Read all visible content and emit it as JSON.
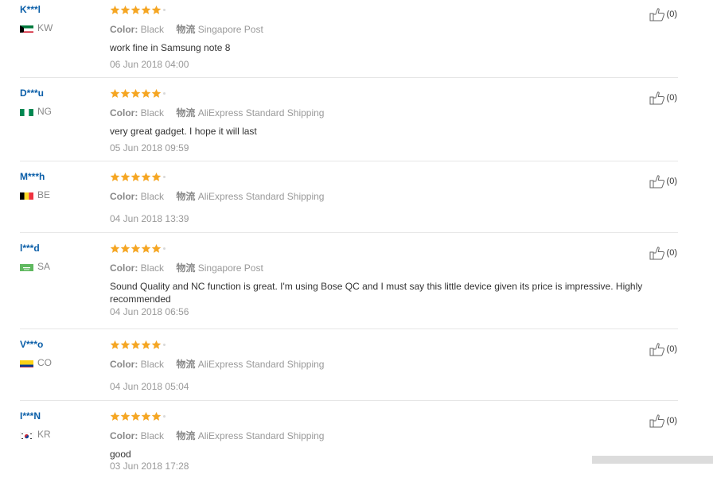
{
  "reviews": [
    {
      "user": "K***l",
      "country": "KW",
      "rating": 5,
      "color_label": "Color:",
      "color": "Black",
      "shipping_label": "物流",
      "shipping": "Singapore Post",
      "content": "work fine in Samsung note 8",
      "date": "06 Jun 2018 04:00",
      "helpful": "(0)"
    },
    {
      "user": "D***u",
      "country": "NG",
      "rating": 5,
      "color_label": "Color:",
      "color": "Black",
      "shipping_label": "物流",
      "shipping": "AliExpress Standard Shipping",
      "content": "very great gadget. I hope it will last",
      "date": "05 Jun 2018 09:59",
      "helpful": "(0)"
    },
    {
      "user": "M***h",
      "country": "BE",
      "rating": 5,
      "color_label": "Color:",
      "color": "Black",
      "shipping_label": "物流",
      "shipping": "AliExpress Standard Shipping",
      "content": "",
      "date": "04 Jun 2018 13:39",
      "helpful": "(0)"
    },
    {
      "user": "l***d",
      "country": "SA",
      "rating": 5,
      "color_label": "Color:",
      "color": "Black",
      "shipping_label": "物流",
      "shipping": "Singapore Post",
      "content": "Sound Quality and NC function is great. I'm using Bose QC and I must say this little device given its price is impressive. Highly recommended",
      "date": "04 Jun 2018 06:56",
      "helpful": "(0)"
    },
    {
      "user": "V***o",
      "country": "CO",
      "rating": 5,
      "color_label": "Color:",
      "color": "Black",
      "shipping_label": "物流",
      "shipping": "AliExpress Standard Shipping",
      "content": "",
      "date": "04 Jun 2018 05:04",
      "helpful": "(0)"
    },
    {
      "user": "I***N",
      "country": "KR",
      "rating": 5,
      "color_label": "Color:",
      "color": "Black",
      "shipping_label": "物流",
      "shipping": "AliExpress Standard Shipping",
      "content": "good",
      "date": "03 Jun 2018 17:28",
      "helpful": "(0)"
    }
  ],
  "colors": {
    "star": "#f5a623",
    "username": "#0a5ea8",
    "divider": "#e6e6e6"
  },
  "icons": {
    "rating": "star-icon",
    "helpful": "thumbs-up-icon"
  }
}
